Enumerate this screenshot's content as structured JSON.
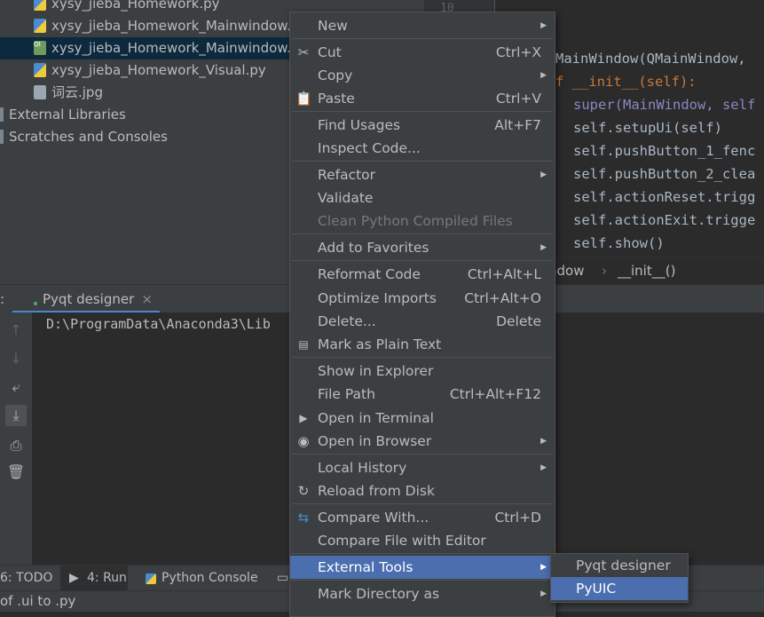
{
  "project_tree": {
    "files": [
      {
        "name": "xysy_jieba_Homework.py",
        "type": "py"
      },
      {
        "name": "xysy_jieba_Homework_Mainwindow.py",
        "type": "py"
      },
      {
        "name": "xysy_jieba_Homework_Mainwindow.ui",
        "type": "ui"
      },
      {
        "name": "xysy_jieba_Homework_Visual.py",
        "type": "py"
      },
      {
        "name": "词云.jpg",
        "type": "jpg"
      }
    ],
    "external_libraries": "External Libraries",
    "scratches": "Scratches and Consoles"
  },
  "editor": {
    "line_number": "10",
    "lines": [
      "MainWindow(QMainWindow, ",
      "f __init__(self):",
      "super(MainWindow, self",
      "self.setupUi(self)",
      "self.pushButton_1_fenc",
      "self.pushButton_2_clea",
      "self.actionReset.trigg",
      "self.actionExit.trigge",
      "self.show()"
    ],
    "breadcrumb": [
      "ndow",
      "__init__()"
    ]
  },
  "run_window": {
    "colon": ":",
    "tab_label": "Pyqt designer",
    "tab_close": "×",
    "console_text": "D:\\ProgramData\\Anaconda3\\Lib"
  },
  "context_menu": {
    "new": "New",
    "cut": "Cut",
    "cut_shortcut": "Ctrl+X",
    "copy": "Copy",
    "paste": "Paste",
    "paste_shortcut": "Ctrl+V",
    "find_usages": "Find Usages",
    "find_usages_shortcut": "Alt+F7",
    "inspect_code": "Inspect Code...",
    "refactor": "Refactor",
    "validate": "Validate",
    "clean_python": "Clean Python Compiled Files",
    "add_favorites": "Add to Favorites",
    "reformat": "Reformat Code",
    "reformat_shortcut": "Ctrl+Alt+L",
    "optimize": "Optimize Imports",
    "optimize_shortcut": "Ctrl+Alt+O",
    "delete": "Delete...",
    "delete_shortcut": "Delete",
    "mark_plain": "Mark as Plain Text",
    "show_explorer": "Show in Explorer",
    "file_path": "File Path",
    "file_path_shortcut": "Ctrl+Alt+F12",
    "open_terminal": "Open in Terminal",
    "open_browser": "Open in Browser",
    "local_history": "Local History",
    "reload": "Reload from Disk",
    "compare_with": "Compare With...",
    "compare_with_shortcut": "Ctrl+D",
    "compare_editor": "Compare File with Editor",
    "external_tools": "External Tools",
    "mark_directory": "Mark Directory as"
  },
  "submenu": {
    "pyqt_designer": "Pyqt designer",
    "pyuic": "PyUIC"
  },
  "bottom_tabs": {
    "todo": "6: TODO",
    "run": "4: Run",
    "python_console": "Python Console"
  },
  "status_bar": "of .ui to .py"
}
